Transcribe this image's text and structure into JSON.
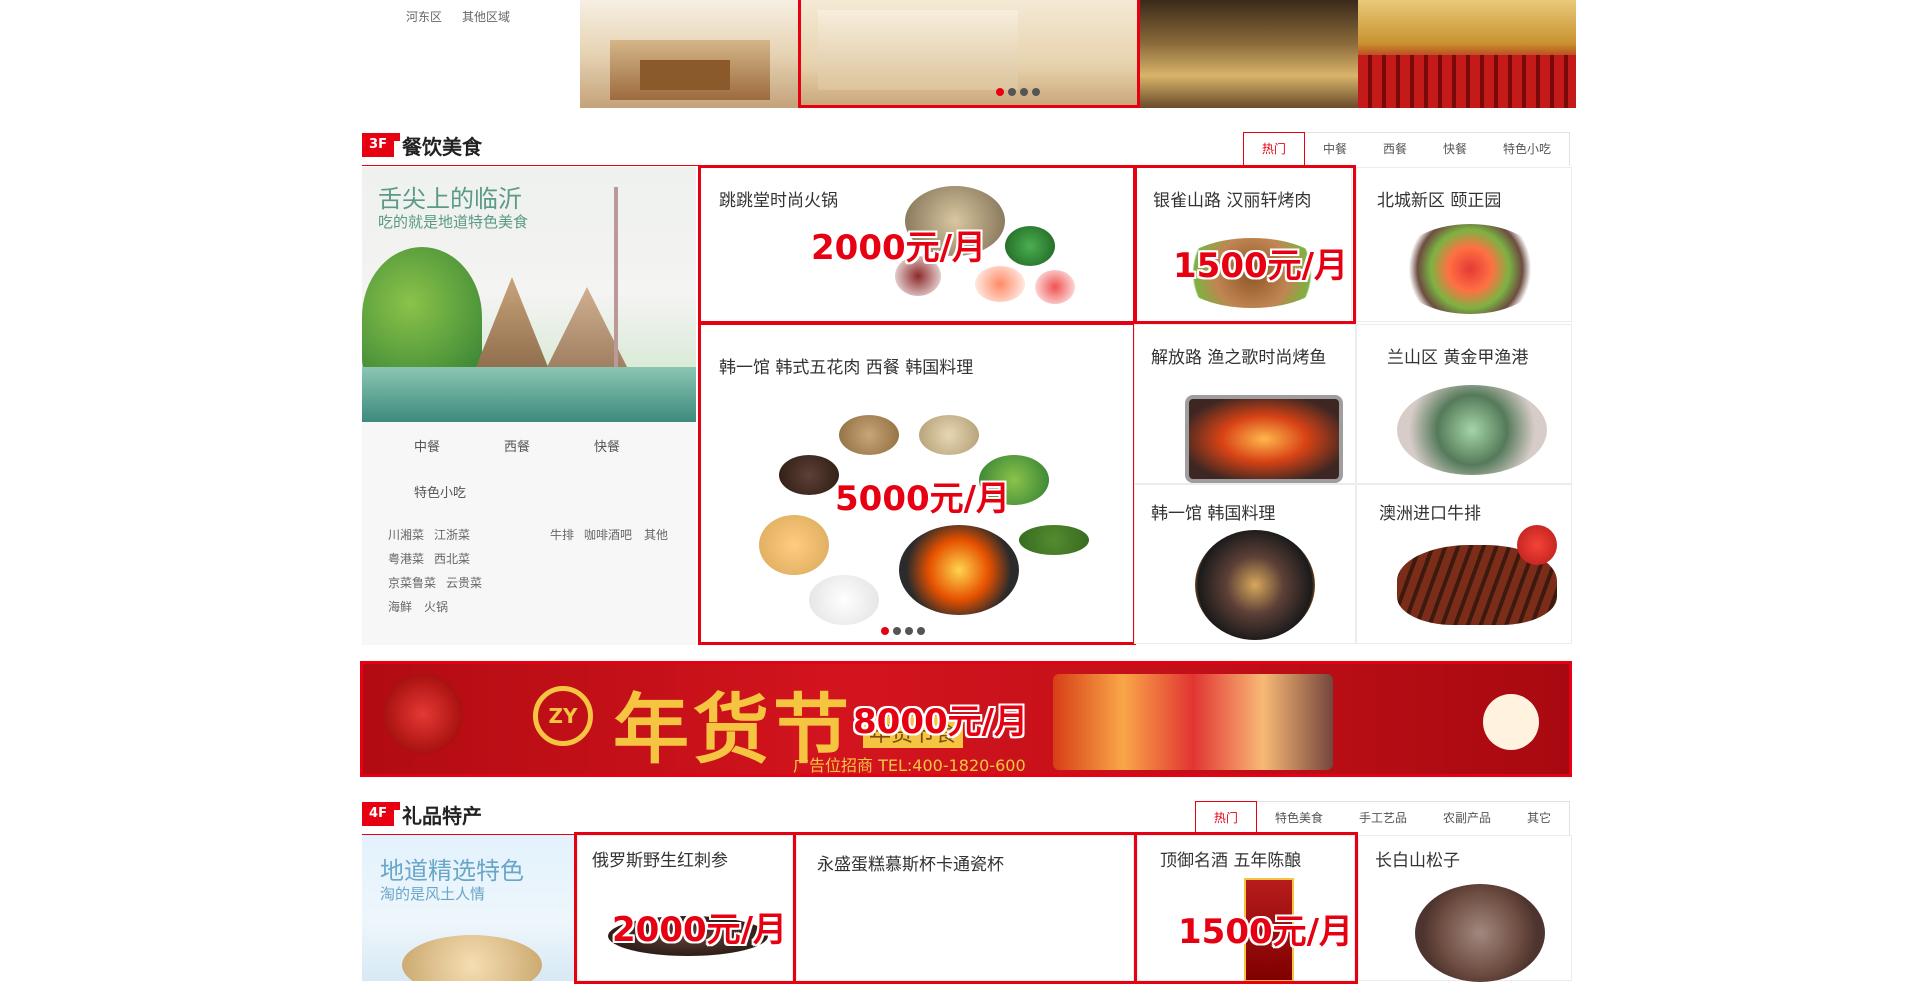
{
  "top": {
    "districts": [
      "河东区",
      "其他区域"
    ]
  },
  "floor3": {
    "badge": "3F",
    "title": "餐饮美食",
    "tabs": [
      "热门",
      "中餐",
      "西餐",
      "快餐",
      "特色小吃"
    ],
    "promo": {
      "headline": "舌尖上的临沂",
      "subline": "吃的就是地道特色美食"
    },
    "categories": [
      "中餐",
      "西餐",
      "快餐",
      "特色小吃"
    ],
    "sub_links": {
      "col1": [
        "川湘菜",
        "江浙菜",
        "粤港菜",
        "西北菜",
        "京菜鲁菜",
        "云贵菜",
        "海鲜",
        "火锅"
      ],
      "col2": [
        "牛排",
        "咖啡酒吧",
        "其他"
      ]
    },
    "items": [
      {
        "title": "跳跳堂时尚火锅",
        "price": "2000元/月"
      },
      {
        "title": "韩一馆 韩式五花肉 西餐 韩国料理",
        "price": "5000元/月"
      },
      {
        "title": "银雀山路 汉丽轩烤肉",
        "price": "1500元/月"
      },
      {
        "title": "北城新区 颐正园"
      },
      {
        "title": "解放路 渔之歌时尚烤鱼"
      },
      {
        "title": "兰山区 黄金甲渔港"
      },
      {
        "title": "韩一馆 韩国料理"
      },
      {
        "title": "澳洲进口牛排"
      }
    ]
  },
  "banner": {
    "logo": "ZY",
    "headline": "年货节",
    "sub": "年货节食",
    "price": "8000元/月",
    "contact": "广告位招商 TEL:400-1820-600"
  },
  "floor4": {
    "badge": "4F",
    "title": "礼品特产",
    "tabs": [
      "热门",
      "特色美食",
      "手工艺品",
      "农副产品",
      "其它"
    ],
    "promo": {
      "headline": "地道精选特色",
      "subline": "淘的是风土人情"
    },
    "items": [
      {
        "title": "俄罗斯野生红刺参",
        "price": "2000元/月"
      },
      {
        "title": "永盛蛋糕慕斯杯卡通瓷杯"
      },
      {
        "title": "顶御名酒 五年陈酿",
        "price": "1500元/月"
      },
      {
        "title": "长白山松子"
      }
    ]
  },
  "colors": {
    "accent": "#e60012",
    "banner_bg": "#c8101a",
    "gold": "#f5c542"
  }
}
